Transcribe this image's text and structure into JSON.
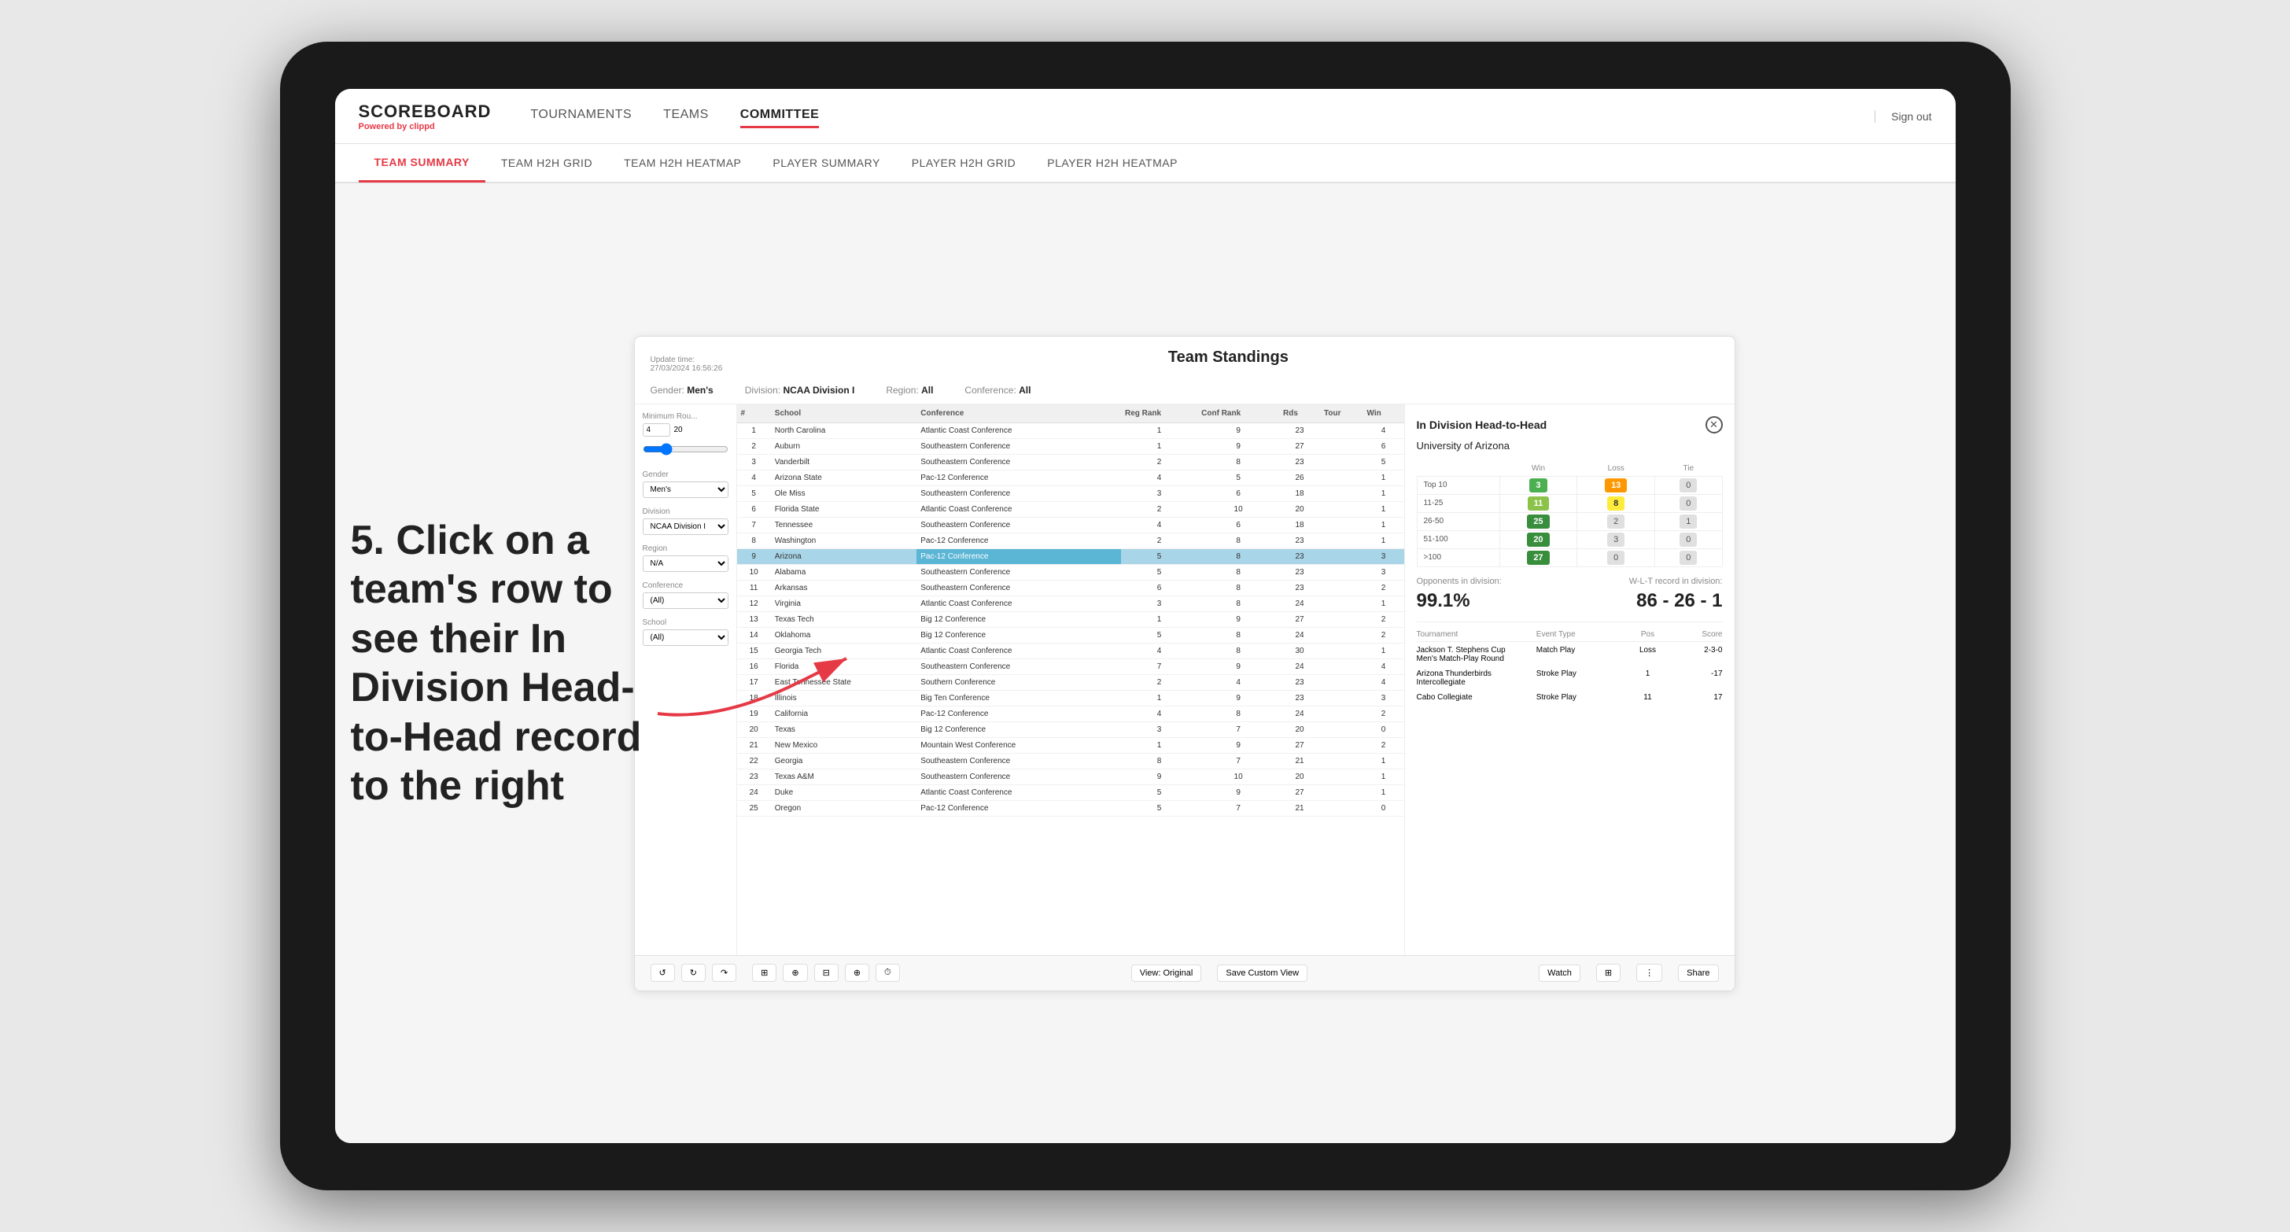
{
  "app": {
    "logo_title": "SCOREBOARD",
    "logo_subtitle_prefix": "Powered by ",
    "logo_subtitle_brand": "clippd",
    "sign_out_label": "Sign out"
  },
  "top_nav": {
    "links": [
      {
        "label": "TOURNAMENTS",
        "active": false
      },
      {
        "label": "TEAMS",
        "active": false
      },
      {
        "label": "COMMITTEE",
        "active": true
      }
    ]
  },
  "secondary_nav": {
    "links": [
      {
        "label": "TEAM SUMMARY",
        "active": true
      },
      {
        "label": "TEAM H2H GRID",
        "active": false
      },
      {
        "label": "TEAM H2H HEATMAP",
        "active": false
      },
      {
        "label": "PLAYER SUMMARY",
        "active": false
      },
      {
        "label": "PLAYER H2H GRID",
        "active": false
      },
      {
        "label": "PLAYER H2H HEATMAP",
        "active": false
      }
    ]
  },
  "annotation": {
    "text": "5. Click on a team's row to see their In Division Head-to-Head record to the right"
  },
  "panel": {
    "update_time_label": "Update time:",
    "update_time_value": "27/03/2024 16:56:26",
    "title": "Team Standings",
    "filters": {
      "gender_label": "Gender:",
      "gender_value": "Men's",
      "division_label": "Division:",
      "division_value": "NCAA Division I",
      "region_label": "Region:",
      "region_value": "All",
      "conference_label": "Conference:",
      "conference_value": "All"
    }
  },
  "sidebar": {
    "min_rou_label": "Minimum Rou...",
    "min_rou_value": "4",
    "min_rou_max": "20",
    "gender_label": "Gender",
    "gender_options": [
      "Men's"
    ],
    "division_label": "Division",
    "division_options": [
      "NCAA Division I"
    ],
    "region_label": "Region",
    "region_options": [
      "N/A"
    ],
    "conference_label": "Conference",
    "conference_options": [
      "(All)"
    ],
    "school_label": "School",
    "school_options": [
      "(All)"
    ]
  },
  "table": {
    "headers": [
      "#",
      "School",
      "Conference",
      "Reg Rank",
      "Conf Rank",
      "Rds",
      "Tour",
      "Win"
    ],
    "rows": [
      {
        "rank": 1,
        "school": "North Carolina",
        "conference": "Atlantic Coast Conference",
        "reg_rank": 1,
        "conf_rank": 9,
        "rds": 23,
        "tour": "",
        "win": 4,
        "highlighted": false
      },
      {
        "rank": 2,
        "school": "Auburn",
        "conference": "Southeastern Conference",
        "reg_rank": 1,
        "conf_rank": 9,
        "rds": 27,
        "tour": "",
        "win": 6,
        "highlighted": false
      },
      {
        "rank": 3,
        "school": "Vanderbilt",
        "conference": "Southeastern Conference",
        "reg_rank": 2,
        "conf_rank": 8,
        "rds": 23,
        "tour": "",
        "win": 5,
        "highlighted": false
      },
      {
        "rank": 4,
        "school": "Arizona State",
        "conference": "Pac-12 Conference",
        "reg_rank": 4,
        "conf_rank": 5,
        "rds": 26,
        "tour": "",
        "win": 1,
        "highlighted": false
      },
      {
        "rank": 5,
        "school": "Ole Miss",
        "conference": "Southeastern Conference",
        "reg_rank": 3,
        "conf_rank": 6,
        "rds": 18,
        "tour": "",
        "win": 1,
        "highlighted": false
      },
      {
        "rank": 6,
        "school": "Florida State",
        "conference": "Atlantic Coast Conference",
        "reg_rank": 2,
        "conf_rank": 10,
        "rds": 20,
        "tour": "",
        "win": 1,
        "highlighted": false
      },
      {
        "rank": 7,
        "school": "Tennessee",
        "conference": "Southeastern Conference",
        "reg_rank": 4,
        "conf_rank": 6,
        "rds": 18,
        "tour": "",
        "win": 1,
        "highlighted": false
      },
      {
        "rank": 8,
        "school": "Washington",
        "conference": "Pac-12 Conference",
        "reg_rank": 2,
        "conf_rank": 8,
        "rds": 23,
        "tour": "",
        "win": 1,
        "highlighted": false
      },
      {
        "rank": 9,
        "school": "Arizona",
        "conference": "Pac-12 Conference",
        "reg_rank": 5,
        "conf_rank": 8,
        "rds": 23,
        "tour": "",
        "win": 3,
        "highlighted": true
      },
      {
        "rank": 10,
        "school": "Alabama",
        "conference": "Southeastern Conference",
        "reg_rank": 5,
        "conf_rank": 8,
        "rds": 23,
        "tour": "",
        "win": 3,
        "highlighted": false
      },
      {
        "rank": 11,
        "school": "Arkansas",
        "conference": "Southeastern Conference",
        "reg_rank": 6,
        "conf_rank": 8,
        "rds": 23,
        "tour": "",
        "win": 2,
        "highlighted": false
      },
      {
        "rank": 12,
        "school": "Virginia",
        "conference": "Atlantic Coast Conference",
        "reg_rank": 3,
        "conf_rank": 8,
        "rds": 24,
        "tour": "",
        "win": 1,
        "highlighted": false
      },
      {
        "rank": 13,
        "school": "Texas Tech",
        "conference": "Big 12 Conference",
        "reg_rank": 1,
        "conf_rank": 9,
        "rds": 27,
        "tour": "",
        "win": 2,
        "highlighted": false
      },
      {
        "rank": 14,
        "school": "Oklahoma",
        "conference": "Big 12 Conference",
        "reg_rank": 5,
        "conf_rank": 8,
        "rds": 24,
        "tour": "",
        "win": 2,
        "highlighted": false
      },
      {
        "rank": 15,
        "school": "Georgia Tech",
        "conference": "Atlantic Coast Conference",
        "reg_rank": 4,
        "conf_rank": 8,
        "rds": 30,
        "tour": "",
        "win": 1,
        "highlighted": false
      },
      {
        "rank": 16,
        "school": "Florida",
        "conference": "Southeastern Conference",
        "reg_rank": 7,
        "conf_rank": 9,
        "rds": 24,
        "tour": "",
        "win": 4,
        "highlighted": false
      },
      {
        "rank": 17,
        "school": "East Tennessee State",
        "conference": "Southern Conference",
        "reg_rank": 2,
        "conf_rank": 4,
        "rds": 23,
        "tour": "",
        "win": 4,
        "highlighted": false
      },
      {
        "rank": 18,
        "school": "Illinois",
        "conference": "Big Ten Conference",
        "reg_rank": 1,
        "conf_rank": 9,
        "rds": 23,
        "tour": "",
        "win": 3,
        "highlighted": false
      },
      {
        "rank": 19,
        "school": "California",
        "conference": "Pac-12 Conference",
        "reg_rank": 4,
        "conf_rank": 8,
        "rds": 24,
        "tour": "",
        "win": 2,
        "highlighted": false
      },
      {
        "rank": 20,
        "school": "Texas",
        "conference": "Big 12 Conference",
        "reg_rank": 3,
        "conf_rank": 7,
        "rds": 20,
        "tour": "",
        "win": 0,
        "highlighted": false
      },
      {
        "rank": 21,
        "school": "New Mexico",
        "conference": "Mountain West Conference",
        "reg_rank": 1,
        "conf_rank": 9,
        "rds": 27,
        "tour": "",
        "win": 2,
        "highlighted": false
      },
      {
        "rank": 22,
        "school": "Georgia",
        "conference": "Southeastern Conference",
        "reg_rank": 8,
        "conf_rank": 7,
        "rds": 21,
        "tour": "",
        "win": 1,
        "highlighted": false
      },
      {
        "rank": 23,
        "school": "Texas A&M",
        "conference": "Southeastern Conference",
        "reg_rank": 9,
        "conf_rank": 10,
        "rds": 20,
        "tour": "",
        "win": 1,
        "highlighted": false
      },
      {
        "rank": 24,
        "school": "Duke",
        "conference": "Atlantic Coast Conference",
        "reg_rank": 5,
        "conf_rank": 9,
        "rds": 27,
        "tour": "",
        "win": 1,
        "highlighted": false
      },
      {
        "rank": 25,
        "school": "Oregon",
        "conference": "Pac-12 Conference",
        "reg_rank": 5,
        "conf_rank": 7,
        "rds": 21,
        "tour": "",
        "win": 0,
        "highlighted": false
      }
    ]
  },
  "h2h": {
    "title": "In Division Head-to-Head",
    "team_name": "University of Arizona",
    "columns": [
      "Win",
      "Loss",
      "Tie"
    ],
    "rows": [
      {
        "range": "Top 10",
        "win": 3,
        "loss": 13,
        "tie": 0,
        "win_color": "green",
        "loss_color": "orange",
        "tie_color": "gray"
      },
      {
        "range": "11-25",
        "win": 11,
        "loss": 8,
        "tie": 0,
        "win_color": "light-green",
        "loss_color": "yellow",
        "tie_color": "gray"
      },
      {
        "range": "26-50",
        "win": 25,
        "loss": 2,
        "tie": 1,
        "win_color": "dark-green",
        "loss_color": "gray",
        "tie_color": "gray"
      },
      {
        "range": "51-100",
        "win": 20,
        "loss": 3,
        "tie": 0,
        "win_color": "dark-green",
        "loss_color": "gray",
        "tie_color": "gray"
      },
      {
        "range": ">100",
        "win": 27,
        "loss": 0,
        "tie": 0,
        "win_color": "dark-green",
        "loss_color": "gray",
        "tie_color": "gray"
      }
    ],
    "opponents_label": "Opponents in division:",
    "opponents_value": "99.1%",
    "wlt_label": "W-L-T record in division:",
    "wlt_value": "86 - 26 - 1",
    "tournaments": [
      {
        "name": "Jackson T. Stephens Cup Men's Match-Play Round",
        "event_type": "Match Play",
        "pos": "Loss",
        "score": "2-3-0"
      },
      {
        "name": "Arizona Thunderbirds Intercollegiate",
        "event_type": "Stroke Play",
        "pos": "1",
        "score": "-17"
      },
      {
        "name": "Cabo Collegiate",
        "event_type": "Stroke Play",
        "pos": "11",
        "score": "17"
      }
    ],
    "tournament_headers": [
      "Tournament",
      "Event Type",
      "Pos",
      "Score"
    ]
  },
  "toolbar": {
    "view_original_label": "View: Original",
    "save_custom_view_label": "Save Custom View",
    "watch_label": "Watch",
    "share_label": "Share"
  }
}
